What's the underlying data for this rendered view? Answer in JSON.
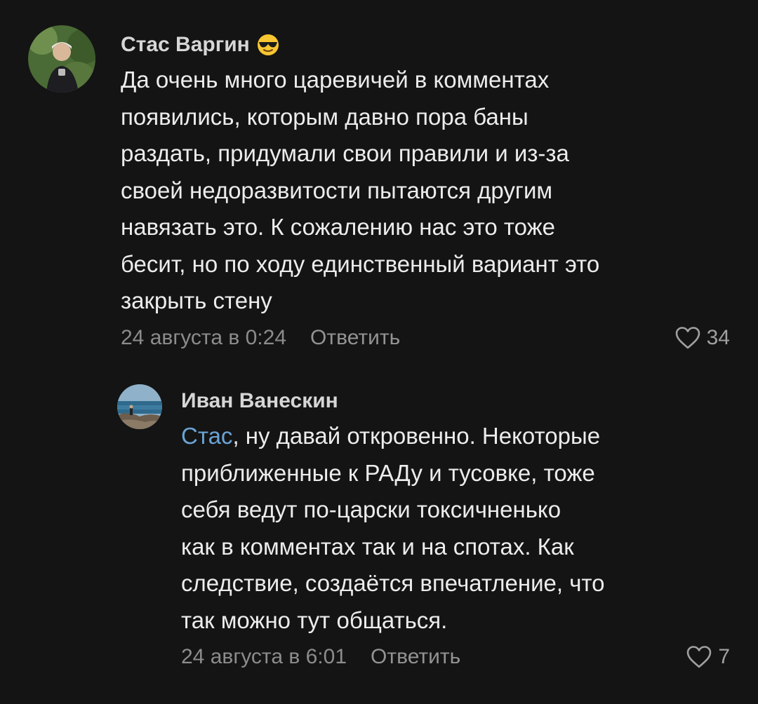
{
  "comments": [
    {
      "author": "Стас Варгин",
      "emoji_icon": "smiling-face-with-sunglasses",
      "text_lines": [
        "Да очень много царевичей в комментах",
        "появились, которым давно пора баны",
        "раздать, придумали свои правили и из-за",
        "своей недоразвитости пытаются другим",
        "навязать это. К сожалению нас это тоже",
        "бесит, но по ходу единственный вариант это",
        "закрыть стену"
      ],
      "date": "24 августа в 0:24",
      "reply_label": "Ответить",
      "likes": "34"
    },
    {
      "author": "Иван Ванескин",
      "mention": "Стас",
      "first_line_rest": ", ну давай откровенно. Некоторые",
      "text_lines": [
        "приближенные к РАДу и тусовке, тоже",
        "себя ведут по-царски токсичненько",
        "как в комментах так и на спотах. Как",
        "следствие, создаётся впечатление, что",
        "так можно тут общаться."
      ],
      "date": "24 августа в 6:01",
      "reply_label": "Ответить",
      "likes": "7"
    }
  ],
  "colors": {
    "background": "#141414",
    "mention": "#6aa3d6",
    "meta": "#8c8c8c"
  }
}
